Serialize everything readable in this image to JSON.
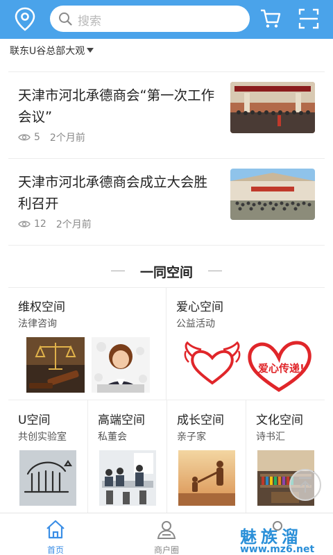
{
  "header": {
    "search_placeholder": "搜索",
    "accent": "#4aa3ea"
  },
  "org": {
    "name": "联东U谷总部大观"
  },
  "news": [
    {
      "title": "天津市河北承德商会“第一次工作会议”",
      "views": "5",
      "time": "2个月前"
    },
    {
      "title": "天津市河北承德商会成立大会胜利召开",
      "views": "12",
      "time": "2个月前"
    }
  ],
  "section": {
    "title": "一同空间"
  },
  "spaces_top": [
    {
      "title": "维权空间",
      "sub": "法律咨询"
    },
    {
      "title": "爱心空间",
      "sub": "公益活动",
      "image_text": "爱心传递!"
    }
  ],
  "spaces_bottom": [
    {
      "title": "U空间",
      "sub": "共创实验室"
    },
    {
      "title": "高端空间",
      "sub": "私董会"
    },
    {
      "title": "成长空间",
      "sub": "亲子家"
    },
    {
      "title": "文化空间",
      "sub": "诗书汇"
    }
  ],
  "tabs": [
    {
      "label": "首页",
      "icon": "home-icon",
      "active": true
    },
    {
      "label": "商户圈",
      "icon": "merchant-circle-icon",
      "active": false
    },
    {
      "label": "",
      "icon": "profile-icon",
      "active": false
    }
  ],
  "watermark": {
    "brand": "魅族溜",
    "url": "www.mz6.net"
  }
}
